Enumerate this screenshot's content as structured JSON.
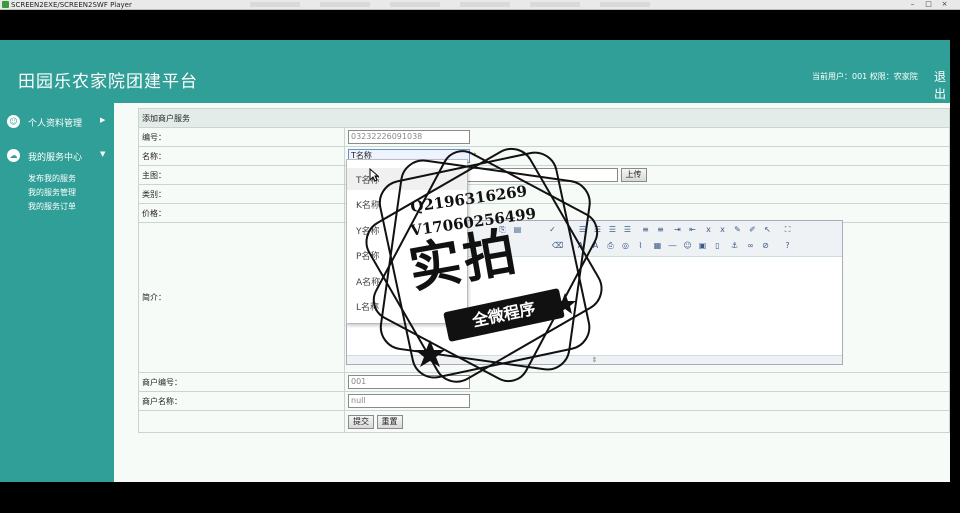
{
  "player": {
    "title": "SCREEN2EXE/SCREEN2SWF Player",
    "minimize": "–",
    "restore": "□",
    "close": "×"
  },
  "header": {
    "title": "田园乐农家院团建平台",
    "user_info": "当前用户：001 权限：农家院",
    "logout": "退出"
  },
  "sidebar": {
    "groups": [
      {
        "label": "个人资料管理",
        "icon": "user-icon"
      },
      {
        "label": "我的服务中心",
        "icon": "cloud-icon"
      }
    ],
    "sub_items": [
      "发布我的服务",
      "我的服务管理",
      "我的服务订单"
    ]
  },
  "form": {
    "section_title": "添加商户服务",
    "rows": {
      "code": {
        "label": "编号：",
        "value": "03232226091038"
      },
      "name": {
        "label": "名称：",
        "value": "T名称",
        "required": "*"
      },
      "image": {
        "label": "主图：",
        "upload": "上传"
      },
      "category": {
        "label": "类别："
      },
      "price": {
        "label": "价格："
      },
      "intro": {
        "label": "简介："
      },
      "merchant_code": {
        "label": "商户编号：",
        "value": "001"
      },
      "merchant_name": {
        "label": "商户名称：",
        "value": "null"
      }
    },
    "submit": "提交",
    "reset": "重置"
  },
  "dropdown": {
    "items": [
      "T名称",
      "K名称",
      "Y名称",
      "P名称",
      "A名称",
      "L名称"
    ]
  },
  "editor": {
    "resize_grip": "⇕"
  },
  "watermark": {
    "contact1": "Q2196316269",
    "contact2": "V17060256499",
    "main": "实拍",
    "banner": "全微程序"
  },
  "colors": {
    "brand": "#2f9f97",
    "background": "#f7fbf8"
  }
}
